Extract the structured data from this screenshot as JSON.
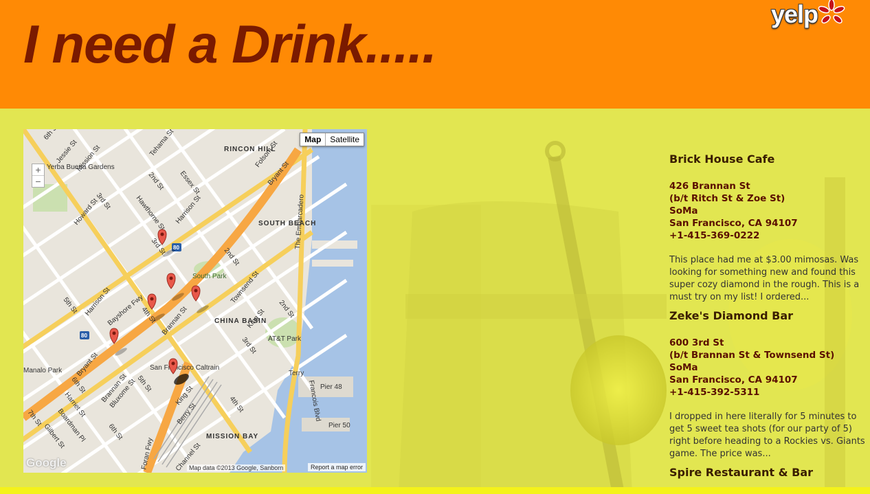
{
  "header": {
    "title": "I need a Drink.....",
    "logo_text": "yelp"
  },
  "map": {
    "type_buttons": [
      "Map",
      "Satellite"
    ],
    "active_type": "Map",
    "zoom_in": "+",
    "zoom_out": "−",
    "attribution": "Map data ©2013 Google, Sanborn",
    "report_link": "Report a map error",
    "google_logo": "Google",
    "labels": {
      "rincon_hill": "RINCON HILL",
      "south_beach": "SOUTH BEACH",
      "china_basin": "CHINA BASIN",
      "mission_bay": "MISSION BAY",
      "yerba_buena": "Yerba Buena Gardens",
      "south_park": "South Park",
      "att_park": "AT&T Park",
      "embarcadero": "The Embarcadero",
      "pier48": "Pier 48",
      "pier50": "Pier 50",
      "sf_caltrain": "San Francisco Caltrain",
      "bayshore": "Bayshore Fwy",
      "foran": "Foran Fwy",
      "manalo_park": "Manalo Park",
      "terry": "Terry",
      "francois": "Francois Blvd",
      "king_st": "King St",
      "townsend_st": "Townsend St",
      "brannan_st": "Brannan St",
      "harrison_st": "Harrison St",
      "bryant_st": "Bryant St",
      "howard_st": "Howard St",
      "mission_st": "Mission St",
      "folsom_st": "Folsom St",
      "third_st": "3rd St",
      "fourth_st": "4th St",
      "second_st": "2nd St",
      "fifth_st": "5th St",
      "sixth_st": "6th St",
      "seventh_st": "7th St",
      "essex_st": "Essex St",
      "tehama_st": "Tehama St",
      "hawthorne_st": "Hawthorne St",
      "jessie_st": "Jessie St",
      "san_francisco": "San Francisco",
      "i80": "80",
      "berry_st": "Berry St",
      "channel_st": "Channel St",
      "gilbert_st": "Gilbert St",
      "harriet_st": "Harriet St",
      "boardman_pl": "Boardman Pl",
      "bluxome_st": "Bluxome St"
    }
  },
  "listings": [
    {
      "name": "Brick House Cafe",
      "street": "426 Brannan St",
      "cross": "(b/t Ritch St & Zoe St)",
      "neighborhood": "SoMa",
      "city": "San Francisco, CA 94107",
      "phone": "+1-415-369-0222",
      "review": [
        "This place had me at $3.00 mimosas. Was",
        "looking for something new and found this",
        "super cozy diamond in the rough. This is a",
        "must try on my list! I ordered..."
      ]
    },
    {
      "name": "Zeke's Diamond Bar",
      "street": "600 3rd St",
      "cross": "(b/t Brannan St & Townsend St)",
      "neighborhood": "SoMa",
      "city": "San Francisco, CA 94107",
      "phone": "+1-415-392-5311",
      "review": [
        "I dropped in here literally for 5 minutes to",
        "get 5 sweet tea shots (for our party of 5)",
        "right before heading to a Rockies vs. Giants",
        "game. The price was..."
      ]
    },
    {
      "name": "Spire Restaurant & Bar"
    }
  ],
  "colors": {
    "header_bg": "#ff8a05",
    "title": "#7a1a00",
    "body_bg": "#e2e651",
    "map_marker": "#e8584a"
  }
}
